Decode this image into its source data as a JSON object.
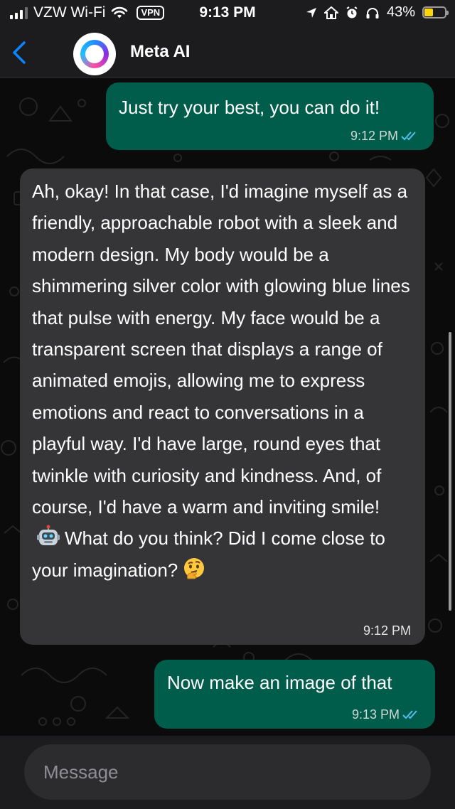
{
  "status_bar": {
    "carrier": "VZW Wi-Fi",
    "vpn": "VPN",
    "time": "9:13 PM",
    "battery": "43%",
    "battery_level": 0.43,
    "icons": [
      "signal-icon",
      "wifi-icon",
      "location-icon",
      "home-icon",
      "alarm-icon",
      "headphones-icon",
      "battery-icon"
    ]
  },
  "header": {
    "back_icon": "chevron-left-icon",
    "contact_name": "Meta AI"
  },
  "messages": [
    {
      "direction": "outgoing",
      "text": "Just try your best, you can do it!",
      "time": "9:12 PM",
      "read": true
    },
    {
      "direction": "incoming",
      "text_main": "Ah, okay! In that case, I'd imagine myself as a friendly, approachable robot with a sleek and modern design. My body would be a shimmering silver color with glowing blue lines that pulse with energy. My face would be a transparent screen that displays a range of animated emojis, allowing me to express emotions and react to conversations in a playful way. I'd have large, round eyes that twinkle with curiosity and kindness. And, of course, I'd have a warm and inviting smile!",
      "emoji_1": "robot-emoji",
      "text_mid": "What do you think? Did I come close to your imagination?",
      "emoji_2": "thinking-face-emoji",
      "time": "9:12 PM"
    },
    {
      "direction": "outgoing",
      "text": "Now make an image of that",
      "time": "9:13 PM",
      "read": true
    }
  ],
  "composer": {
    "placeholder": "Message"
  },
  "colors": {
    "outgoing_bubble": "#005c4b",
    "incoming_bubble": "#353537",
    "background": "#0b0b0b",
    "read_ticks": "#53bdeb",
    "back_arrow": "#0a84ff"
  }
}
